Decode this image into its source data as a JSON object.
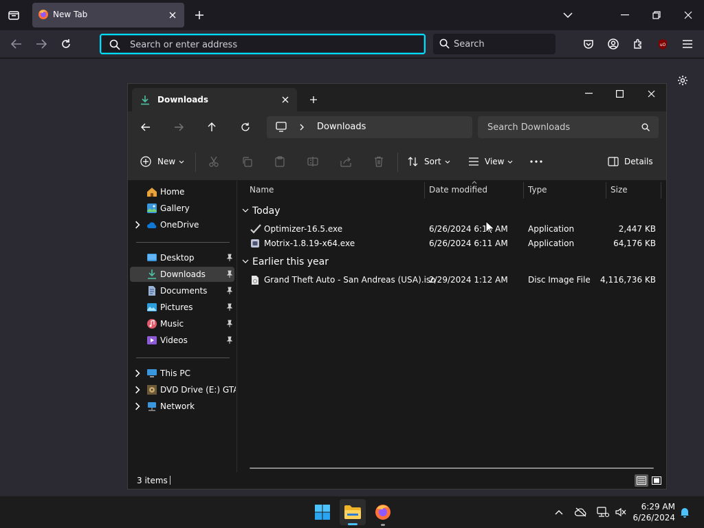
{
  "firefox": {
    "tab": {
      "title": "New Tab"
    },
    "urlbar": {
      "placeholder": "Search or enter address"
    },
    "searchbar": {
      "placeholder": "Search"
    }
  },
  "explorer": {
    "tab": {
      "title": "Downloads"
    },
    "address": {
      "current": "Downloads"
    },
    "search": {
      "placeholder": "Search Downloads"
    },
    "commands": {
      "new_label": "New",
      "sort_label": "Sort",
      "view_label": "View",
      "details_label": "Details"
    },
    "sidebar": {
      "items": [
        {
          "label": "Home",
          "icon": "home-icon"
        },
        {
          "label": "Gallery",
          "icon": "gallery-icon"
        },
        {
          "label": "OneDrive",
          "icon": "cloud-icon"
        },
        {
          "label": "Desktop",
          "icon": "desktop-icon"
        },
        {
          "label": "Downloads",
          "icon": "download-icon"
        },
        {
          "label": "Documents",
          "icon": "documents-icon"
        },
        {
          "label": "Pictures",
          "icon": "pictures-icon"
        },
        {
          "label": "Music",
          "icon": "music-icon"
        },
        {
          "label": "Videos",
          "icon": "videos-icon"
        },
        {
          "label": "This PC",
          "icon": "computer-icon"
        },
        {
          "label": "DVD Drive (E:) GTA_S",
          "icon": "dvd-icon"
        },
        {
          "label": "Network",
          "icon": "network-icon"
        }
      ]
    },
    "columns": {
      "name": "Name",
      "date": "Date modified",
      "type": "Type",
      "size": "Size"
    },
    "groups": [
      {
        "label": "Today",
        "files": [
          {
            "name": "Optimizer-16.5.exe",
            "date": "6/26/2024 6:18 AM",
            "type": "Application",
            "size": "2,447 KB"
          },
          {
            "name": "Motrix-1.8.19-x64.exe",
            "date": "6/26/2024 6:11 AM",
            "type": "Application",
            "size": "64,176 KB"
          }
        ]
      },
      {
        "label": "Earlier this year",
        "files": [
          {
            "name": "Grand Theft Auto - San Andreas (USA).iso",
            "date": "2/29/2024 1:12 AM",
            "type": "Disc Image File",
            "size": "4,116,736 KB"
          }
        ]
      }
    ],
    "status": {
      "items": "3 items"
    }
  },
  "taskbar": {
    "time": "6:29 AM",
    "date": "6/26/2024"
  },
  "colors": {
    "accent": "#00ddff",
    "download_green": "#4cc2a4",
    "taskbar_active": "#4cc2ff"
  }
}
